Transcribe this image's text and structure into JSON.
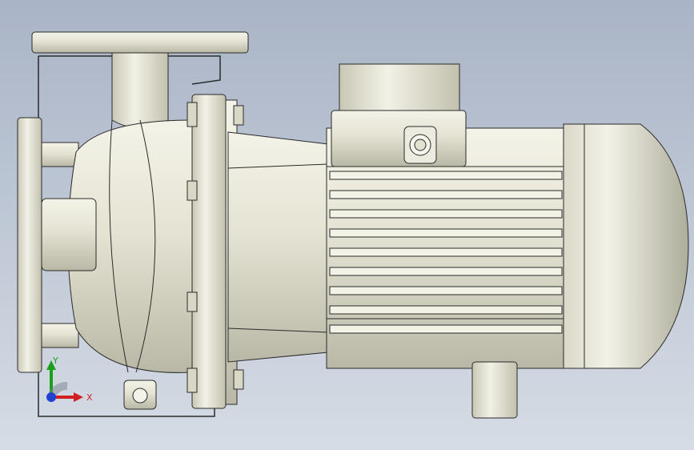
{
  "viewport": {
    "background_top": "#a9b4c6",
    "background_bottom": "#d6dce5"
  },
  "model": {
    "subject": "centrifugal-pump-with-electric-motor",
    "metal_color": "#e7e6d8",
    "shadow_color": "#bdbcaa",
    "edge_color": "#2a2a2a"
  },
  "triad": {
    "x_label": "X",
    "y_label": "Y",
    "x_color": "#d22020",
    "y_color": "#1aa01a",
    "z_color": "#2040d0"
  }
}
